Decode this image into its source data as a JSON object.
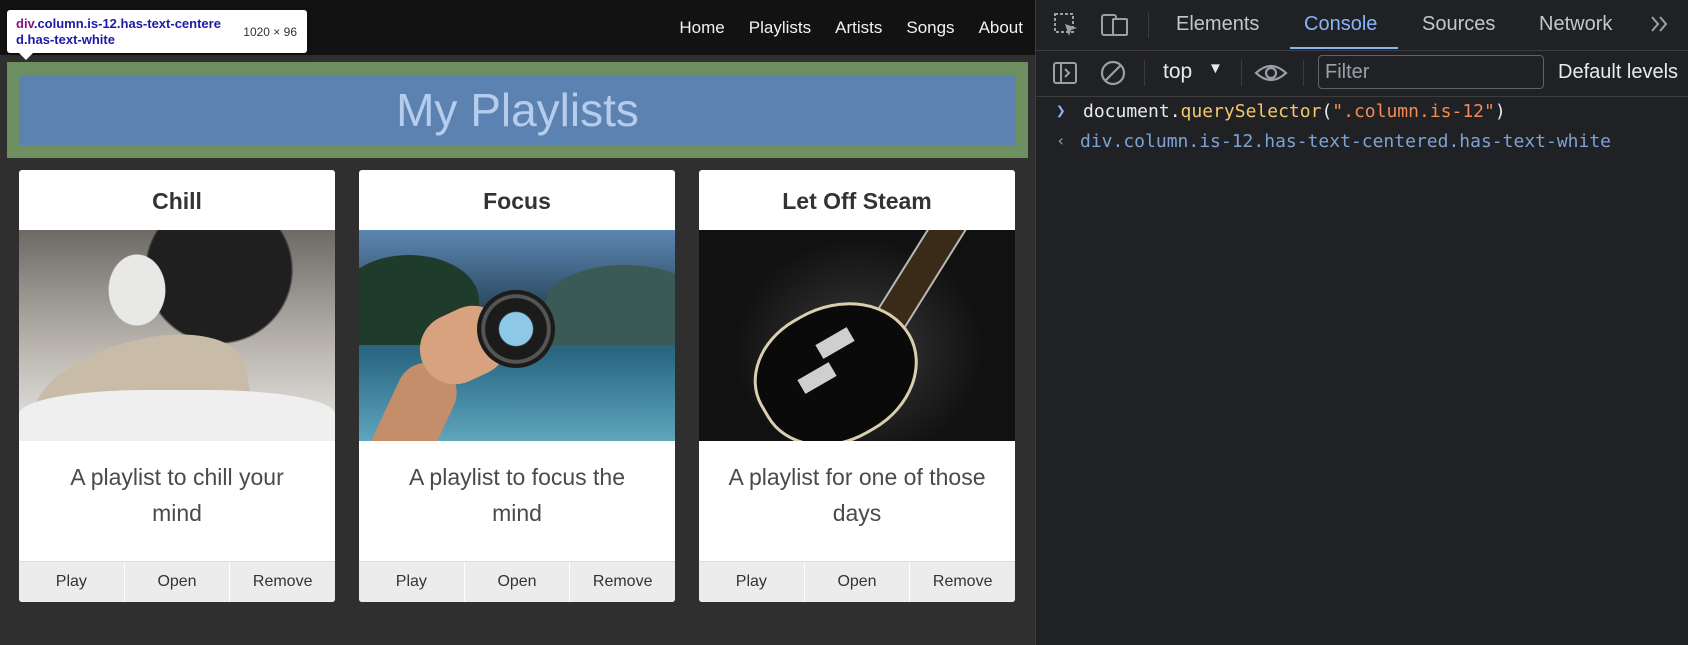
{
  "nav": {
    "links": [
      "Home",
      "Playlists",
      "Artists",
      "Songs",
      "About"
    ]
  },
  "tooltip": {
    "selector_tag": "div",
    "selector_classes": ".column.is-12.has-text-centered.has-text-white",
    "size": "1020 × 96"
  },
  "hero": {
    "title": "My Playlists"
  },
  "playlists": [
    {
      "title": "Chill",
      "image": "person-reading-with-mug",
      "description": "A playlist to chill your mind",
      "buttons": [
        "Play",
        "Open",
        "Remove"
      ]
    },
    {
      "title": "Focus",
      "image": "hand-holding-lens-over-lake",
      "description": "A playlist to focus the mind",
      "buttons": [
        "Play",
        "Open",
        "Remove"
      ]
    },
    {
      "title": "Let Off Steam",
      "image": "electric-guitar-dark",
      "description": "A playlist for one of those days",
      "buttons": [
        "Play",
        "Open",
        "Remove"
      ]
    }
  ],
  "devtools": {
    "tabs": [
      "Elements",
      "Console",
      "Sources",
      "Network"
    ],
    "active_tab": "Console",
    "icons": [
      "inspect-element-icon",
      "device-toolbar-icon",
      "more-tabs-icon",
      "sidebar-toggle-icon",
      "clear-console-icon",
      "live-expression-eye-icon"
    ],
    "context": "top",
    "filter_placeholder": "Filter",
    "levels_label": "Default levels",
    "console": {
      "input_object": "document",
      "input_dot": ".",
      "input_method": "querySelector",
      "input_open": "(",
      "input_arg": "\".column.is-12\"",
      "input_close": ")",
      "output": "div.column.is-12.has-text-centered.has-text-white"
    }
  },
  "colors": {
    "hero_margin": "#6e8f60",
    "hero_content": "#5b82b1",
    "hero_title": "#b5ccec",
    "devtools_bg": "#202124",
    "devtools_accent": "#8ab4f8"
  }
}
